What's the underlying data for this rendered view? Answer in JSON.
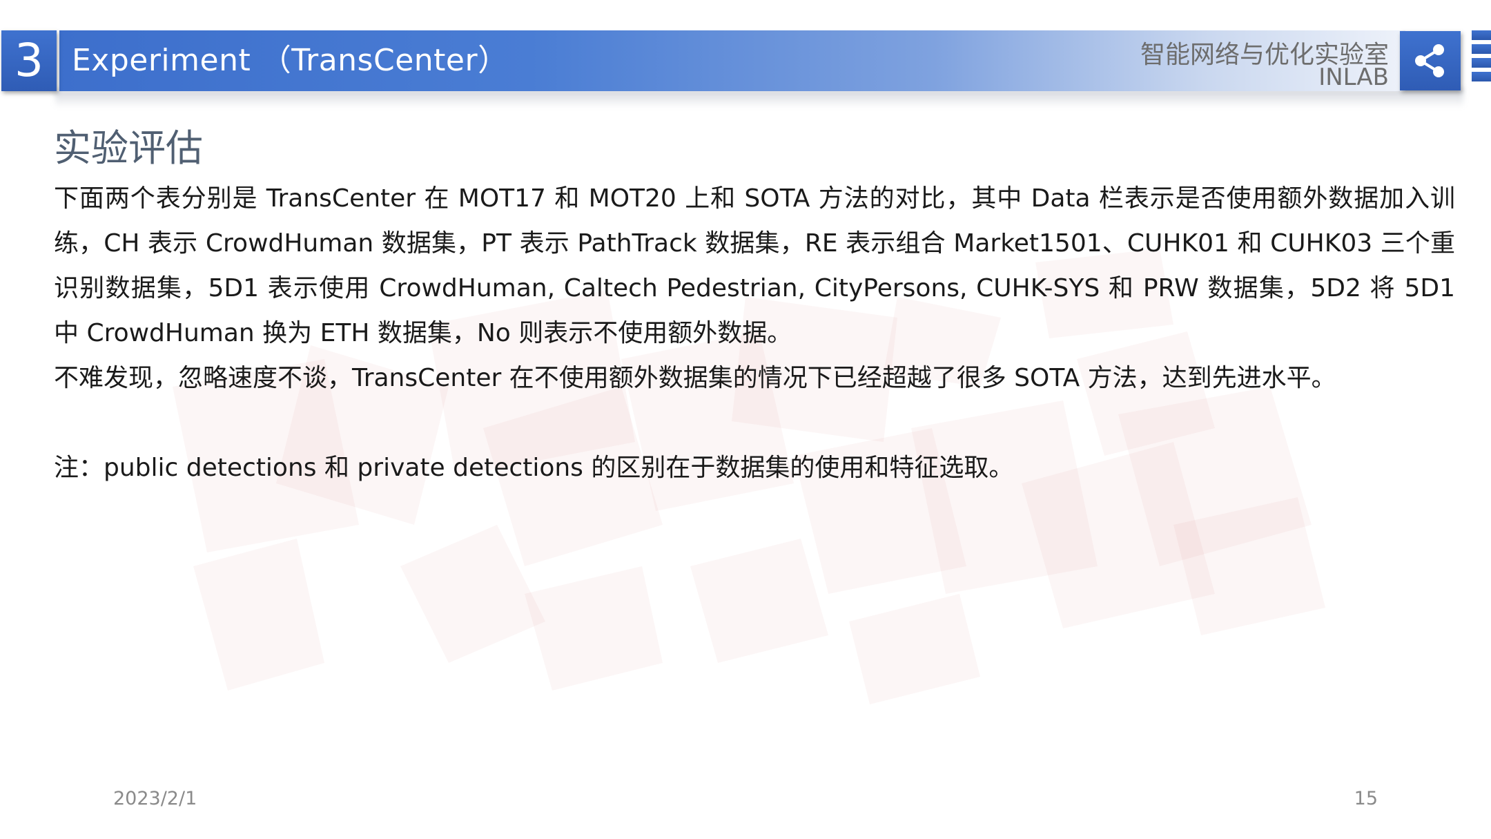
{
  "header": {
    "section_number": "3",
    "title": "Experiment （TransCenter）",
    "lab_name_cn": "智能网络与优化实验室",
    "lab_name_en": "INLAB",
    "share_icon": "share-icon",
    "accent_color": "#3d6fcc"
  },
  "content": {
    "heading": "实验评估",
    "paragraph_1": "下面两个表分别是 TransCenter 在 MOT17 和 MOT20 上和 SOTA 方法的对比，其中 Data 栏表示是否使用额外数据加入训练，CH 表示 CrowdHuman 数据集，PT 表示 PathTrack 数据集，RE 表示组合 Market1501、CUHK01 和 CUHK03 三个重识别数据集，5D1 表示使用 CrowdHuman, Caltech Pedestrian, CityPersons, CUHK-SYS 和 PRW 数据集，5D2 将 5D1 中 CrowdHuman 换为 ETH 数据集，No 则表示不使用额外数据。",
    "paragraph_2": "不难发现，忽略速度不谈，TransCenter 在不使用额外数据集的情况下已经超越了很多 SOTA 方法，达到先进水平。",
    "note": "注：public detections 和 private detections 的区别在于数据集的使用和特征选取。"
  },
  "footer": {
    "date": "2023/2/1",
    "page_number": "15"
  }
}
